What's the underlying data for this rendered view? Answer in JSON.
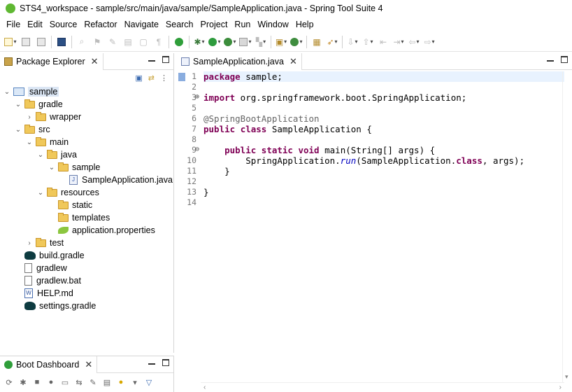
{
  "window": {
    "title": "STS4_workspace - sample/src/main/java/sample/SampleApplication.java - Spring Tool Suite 4"
  },
  "menu": [
    "File",
    "Edit",
    "Source",
    "Refactor",
    "Navigate",
    "Search",
    "Project",
    "Run",
    "Window",
    "Help"
  ],
  "package_explorer": {
    "tab_label": "Package Explorer",
    "tree": [
      {
        "label": "sample",
        "icon": "project-icon",
        "depth": 0,
        "twisty": "v",
        "selected": true
      },
      {
        "label": "gradle",
        "icon": "folder-icon",
        "depth": 1,
        "twisty": "v"
      },
      {
        "label": "wrapper",
        "icon": "folder-icon",
        "depth": 2,
        "twisty": ">"
      },
      {
        "label": "src",
        "icon": "folder-icon",
        "depth": 1,
        "twisty": "v"
      },
      {
        "label": "main",
        "icon": "folder-icon",
        "depth": 2,
        "twisty": "v"
      },
      {
        "label": "java",
        "icon": "folder-icon",
        "depth": 3,
        "twisty": "v"
      },
      {
        "label": "sample",
        "icon": "folder-icon",
        "depth": 4,
        "twisty": "v"
      },
      {
        "label": "SampleApplication.java",
        "icon": "java-file-icon",
        "depth": 5,
        "twisty": ""
      },
      {
        "label": "resources",
        "icon": "folder-icon",
        "depth": 3,
        "twisty": "v"
      },
      {
        "label": "static",
        "icon": "folder-icon",
        "depth": 4,
        "twisty": ""
      },
      {
        "label": "templates",
        "icon": "folder-icon",
        "depth": 4,
        "twisty": ""
      },
      {
        "label": "application.properties",
        "icon": "properties-file-icon",
        "depth": 4,
        "twisty": ""
      },
      {
        "label": "test",
        "icon": "folder-icon",
        "depth": 2,
        "twisty": ">"
      },
      {
        "label": "build.gradle",
        "icon": "gradle-icon",
        "depth": 1,
        "twisty": ""
      },
      {
        "label": "gradlew",
        "icon": "text-file-icon",
        "depth": 1,
        "twisty": ""
      },
      {
        "label": "gradlew.bat",
        "icon": "text-file-icon",
        "depth": 1,
        "twisty": ""
      },
      {
        "label": "HELP.md",
        "icon": "markdown-file-icon",
        "depth": 1,
        "twisty": ""
      },
      {
        "label": "settings.gradle",
        "icon": "gradle-icon",
        "depth": 1,
        "twisty": ""
      }
    ]
  },
  "boot_dashboard": {
    "tab_label": "Boot Dashboard"
  },
  "editor": {
    "tab_label": "SampleApplication.java",
    "lines": [
      {
        "n": "1",
        "html": "<span class='kw'>package</span> sample;",
        "current": true
      },
      {
        "n": "2",
        "html": ""
      },
      {
        "n": "3",
        "html": "<span class='kw'>import</span> org.springframework.boot.SpringApplication;",
        "fold": "+"
      },
      {
        "n": "5",
        "html": ""
      },
      {
        "n": "6",
        "html": "<span class='ann'>@SpringBootApplication</span>"
      },
      {
        "n": "7",
        "html": "<span class='kw'>public</span> <span class='kw'>class</span> SampleApplication {"
      },
      {
        "n": "8",
        "html": ""
      },
      {
        "n": "9",
        "html": "    <span class='kw'>public</span> <span class='kw'>static</span> <span class='kw'>void</span> main(String[] args) {",
        "fold": "-"
      },
      {
        "n": "10",
        "html": "        SpringApplication.<span class='blue'>run</span>(SampleApplication.<span class='kw'>class</span>, args);"
      },
      {
        "n": "11",
        "html": "    }"
      },
      {
        "n": "12",
        "html": ""
      },
      {
        "n": "13",
        "html": "}"
      },
      {
        "n": "14",
        "html": ""
      }
    ]
  }
}
